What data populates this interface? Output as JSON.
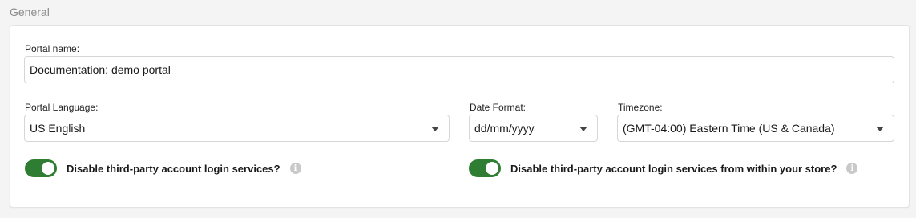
{
  "section": {
    "title": "General"
  },
  "portal_name": {
    "label": "Portal name:",
    "value": "Documentation: demo portal"
  },
  "portal_language": {
    "label": "Portal Language:",
    "value": "US English"
  },
  "date_format": {
    "label": "Date Format:",
    "value": "dd/mm/yyyy"
  },
  "timezone": {
    "label": "Timezone:",
    "value": "(GMT-04:00) Eastern Time (US & Canada)"
  },
  "toggles": [
    {
      "label": "Disable third-party account login services?",
      "state": "on",
      "icon": "info-icon"
    },
    {
      "label": "Disable third-party account login services from within your store?",
      "state": "on",
      "icon": "info-icon"
    }
  ],
  "colors": {
    "toggle_on": "#2e7d32",
    "info_icon": "#c9c9c9"
  }
}
